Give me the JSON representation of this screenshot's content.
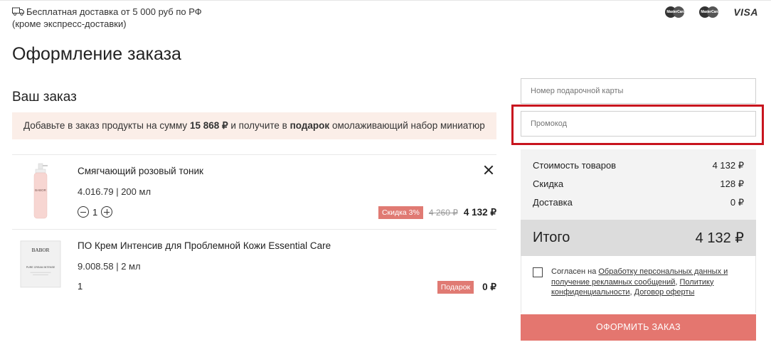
{
  "shipping": {
    "line1": "Бесплатная доставка от 5 000 руб по РФ",
    "line2": "(кроме экспресс-доставки)"
  },
  "payment_icons": [
    {
      "name": "mastercard-icon",
      "text": "MasterCard"
    },
    {
      "name": "maestro-icon",
      "text": "MasterCard"
    },
    {
      "name": "visa-icon",
      "text": "VISA"
    }
  ],
  "page": {
    "title": "Оформление заказа",
    "order_heading": "Ваш заказ"
  },
  "promo_banner": {
    "prefix": "Добавьте в заказ продукты на сумму",
    "amount": "15 868 ₽",
    "middle": "и получите в",
    "gift_word": "подарок",
    "suffix": "омолаживающий набор миниатюр"
  },
  "items": [
    {
      "name": "Смягчающий розовый тоник",
      "sku": "4.016.79 | 200 мл",
      "qty": "1",
      "badge": "Скидка 3%",
      "old_price": "4 260 ₽",
      "price": "4 132 ₽",
      "brand": "BABOR"
    },
    {
      "name": "ПО Крем Интенсив для Проблемной Кожи Essential Care",
      "sku": "9.008.58 | 2 мл",
      "qty": "1",
      "badge": "Подарок",
      "price": "0 ₽",
      "brand": "BABOR",
      "sachet_text": "PURE CREAM INTENSE"
    }
  ],
  "fields": {
    "gift_card_placeholder": "Номер подарочной карты",
    "promo_placeholder": "Промокод"
  },
  "summary": {
    "goods_label": "Стоимость товаров",
    "goods_value": "4 132 ₽",
    "discount_label": "Скидка",
    "discount_value": "128 ₽",
    "delivery_label": "Доставка",
    "delivery_value": "0 ₽",
    "total_label": "Итого",
    "total_value": "4 132 ₽"
  },
  "consent": {
    "text_prefix": "Согласен на",
    "link1": "Обработку персональных данных и получение рекламных сообщений",
    "link2": "Политику конфиденциальности",
    "link3": "Договор оферты"
  },
  "checkout_label": "ОФОРМИТЬ ЗАКАЗ",
  "colors": {
    "accent": "#e4766f",
    "badge": "#e07a73",
    "banner_bg": "#fbeee8",
    "highlight": "#c8141e",
    "summary_bg": "#f3f3f3",
    "total_bg": "#dcdcdc"
  }
}
